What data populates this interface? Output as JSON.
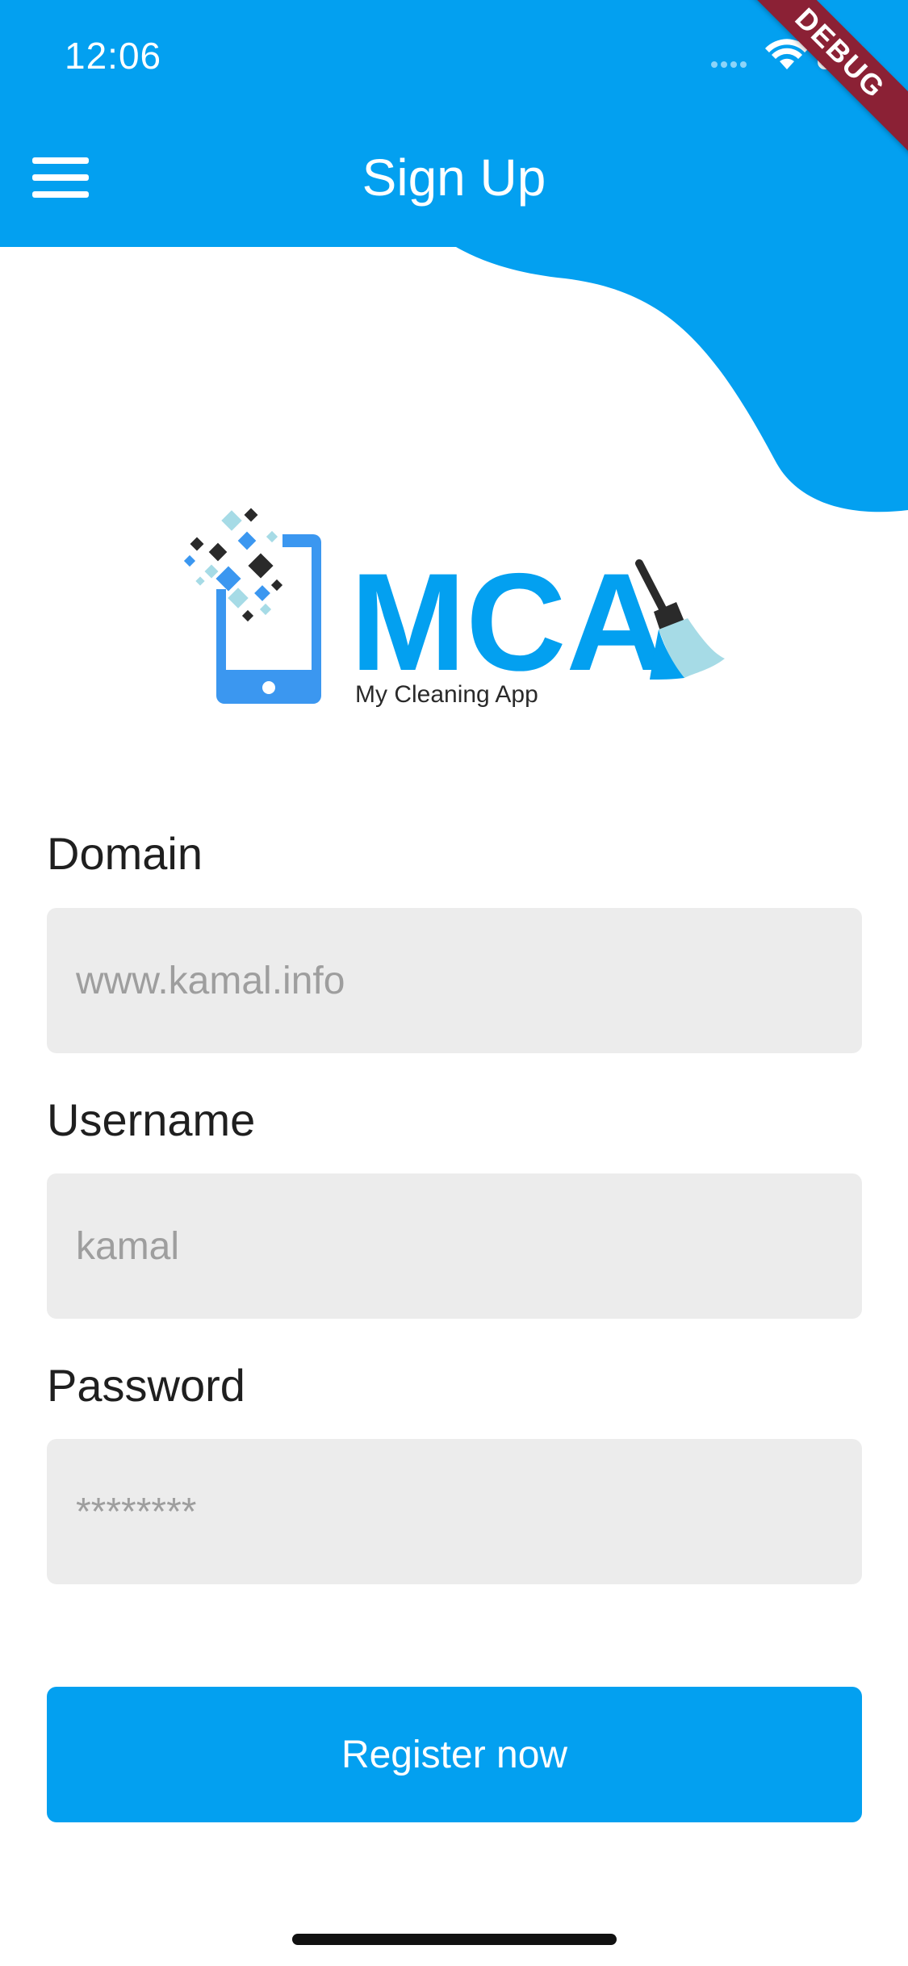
{
  "status_bar": {
    "time": "12:06"
  },
  "debug_banner": {
    "label": "DEBUG"
  },
  "app_bar": {
    "title": "Sign Up"
  },
  "logo": {
    "brand": "MCA",
    "tagline": "My Cleaning App"
  },
  "form": {
    "domain": {
      "label": "Domain",
      "placeholder": "www.kamal.info"
    },
    "username": {
      "label": "Username",
      "placeholder": "kamal"
    },
    "password": {
      "label": "Password",
      "placeholder": "********"
    }
  },
  "register_button": {
    "label": "Register now"
  },
  "colors": {
    "primary": "#03a0f0",
    "field_bg": "#ececec",
    "debug": "#8b2135"
  },
  "icons": [
    "menu-icon",
    "wifi-icon",
    "battery-icon",
    "signal-icon"
  ]
}
